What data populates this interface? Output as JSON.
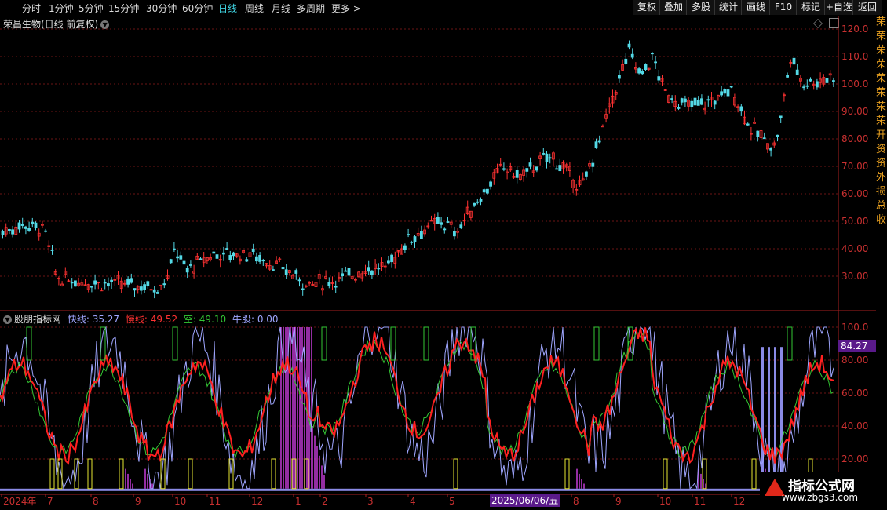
{
  "periods": [
    "分时",
    "1分钟",
    "5分钟",
    "15分钟",
    "30分钟",
    "60分钟",
    "日线",
    "周线",
    "月线",
    "多周期",
    "更多 >"
  ],
  "active_period": "日线",
  "right_buttons": [
    "复权",
    "叠加",
    "多股",
    "统计",
    "画线",
    "F10",
    "标记",
    "+自选",
    "返回"
  ],
  "main": {
    "title": "荣昌生物(日线 前复权)",
    "y_labels": [
      "120.0",
      "110.0",
      "100.0",
      "90.00",
      "80.00",
      "70.00",
      "60.00",
      "50.00",
      "40.00",
      "30.00"
    ],
    "y_values": [
      120,
      110,
      100,
      90,
      80,
      70,
      60,
      50,
      40,
      30
    ]
  },
  "indicator": {
    "name": "股朋指标网",
    "fast_label": "快线: 35.27",
    "slow_label": "慢线: 49.52",
    "empty_label": "空: 49.10",
    "bull_label": "牛股: 0.00",
    "y_labels": [
      "100.0",
      "80.00",
      "60.00",
      "40.00",
      "20.00"
    ],
    "y_values": [
      100,
      80,
      60,
      40,
      20
    ],
    "tag_value": "84.27"
  },
  "x_axis": {
    "labels": [
      "2024年",
      "7",
      "8",
      "9",
      "10",
      "11",
      "12",
      "1",
      "2",
      "3",
      "4",
      "5",
      "2025/06/06/五",
      "8",
      "9",
      "10",
      "11",
      "12"
    ],
    "highlight_date": "2025/06/06/五"
  },
  "watermark": {
    "line1": "指标公式网",
    "line2": "www.zbgs3.com"
  },
  "side_chars": [
    "荣",
    "荣",
    "荣",
    "荣",
    "荣",
    "荣",
    "荣",
    "荣",
    "开",
    "资",
    "资",
    "外",
    "损",
    "总",
    "收"
  ],
  "colors": {
    "up": "#ff3232",
    "down": "#54d9e6",
    "fast": "#9fa6ff",
    "slow": "#ff2020",
    "empty": "#34c834",
    "bull": "#c43cd8",
    "grid": "#6b1414",
    "axis": "#a82020"
  }
}
